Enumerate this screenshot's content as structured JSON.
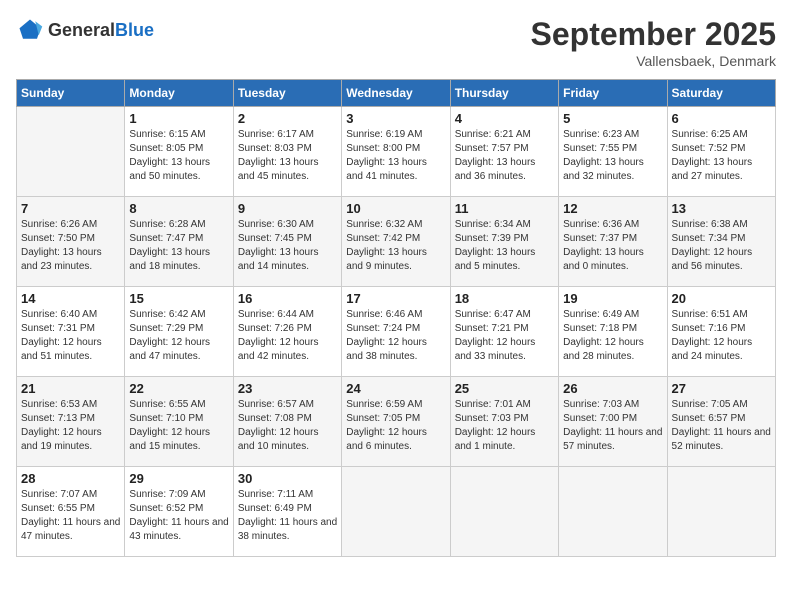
{
  "logo": {
    "text_general": "General",
    "text_blue": "Blue"
  },
  "header": {
    "month": "September 2025",
    "location": "Vallensbaek, Denmark"
  },
  "days_of_week": [
    "Sunday",
    "Monday",
    "Tuesday",
    "Wednesday",
    "Thursday",
    "Friday",
    "Saturday"
  ],
  "weeks": [
    [
      {
        "day": "",
        "sunrise": "",
        "sunset": "",
        "daylight": ""
      },
      {
        "day": "1",
        "sunrise": "Sunrise: 6:15 AM",
        "sunset": "Sunset: 8:05 PM",
        "daylight": "Daylight: 13 hours and 50 minutes."
      },
      {
        "day": "2",
        "sunrise": "Sunrise: 6:17 AM",
        "sunset": "Sunset: 8:03 PM",
        "daylight": "Daylight: 13 hours and 45 minutes."
      },
      {
        "day": "3",
        "sunrise": "Sunrise: 6:19 AM",
        "sunset": "Sunset: 8:00 PM",
        "daylight": "Daylight: 13 hours and 41 minutes."
      },
      {
        "day": "4",
        "sunrise": "Sunrise: 6:21 AM",
        "sunset": "Sunset: 7:57 PM",
        "daylight": "Daylight: 13 hours and 36 minutes."
      },
      {
        "day": "5",
        "sunrise": "Sunrise: 6:23 AM",
        "sunset": "Sunset: 7:55 PM",
        "daylight": "Daylight: 13 hours and 32 minutes."
      },
      {
        "day": "6",
        "sunrise": "Sunrise: 6:25 AM",
        "sunset": "Sunset: 7:52 PM",
        "daylight": "Daylight: 13 hours and 27 minutes."
      }
    ],
    [
      {
        "day": "7",
        "sunrise": "Sunrise: 6:26 AM",
        "sunset": "Sunset: 7:50 PM",
        "daylight": "Daylight: 13 hours and 23 minutes."
      },
      {
        "day": "8",
        "sunrise": "Sunrise: 6:28 AM",
        "sunset": "Sunset: 7:47 PM",
        "daylight": "Daylight: 13 hours and 18 minutes."
      },
      {
        "day": "9",
        "sunrise": "Sunrise: 6:30 AM",
        "sunset": "Sunset: 7:45 PM",
        "daylight": "Daylight: 13 hours and 14 minutes."
      },
      {
        "day": "10",
        "sunrise": "Sunrise: 6:32 AM",
        "sunset": "Sunset: 7:42 PM",
        "daylight": "Daylight: 13 hours and 9 minutes."
      },
      {
        "day": "11",
        "sunrise": "Sunrise: 6:34 AM",
        "sunset": "Sunset: 7:39 PM",
        "daylight": "Daylight: 13 hours and 5 minutes."
      },
      {
        "day": "12",
        "sunrise": "Sunrise: 6:36 AM",
        "sunset": "Sunset: 7:37 PM",
        "daylight": "Daylight: 13 hours and 0 minutes."
      },
      {
        "day": "13",
        "sunrise": "Sunrise: 6:38 AM",
        "sunset": "Sunset: 7:34 PM",
        "daylight": "Daylight: 12 hours and 56 minutes."
      }
    ],
    [
      {
        "day": "14",
        "sunrise": "Sunrise: 6:40 AM",
        "sunset": "Sunset: 7:31 PM",
        "daylight": "Daylight: 12 hours and 51 minutes."
      },
      {
        "day": "15",
        "sunrise": "Sunrise: 6:42 AM",
        "sunset": "Sunset: 7:29 PM",
        "daylight": "Daylight: 12 hours and 47 minutes."
      },
      {
        "day": "16",
        "sunrise": "Sunrise: 6:44 AM",
        "sunset": "Sunset: 7:26 PM",
        "daylight": "Daylight: 12 hours and 42 minutes."
      },
      {
        "day": "17",
        "sunrise": "Sunrise: 6:46 AM",
        "sunset": "Sunset: 7:24 PM",
        "daylight": "Daylight: 12 hours and 38 minutes."
      },
      {
        "day": "18",
        "sunrise": "Sunrise: 6:47 AM",
        "sunset": "Sunset: 7:21 PM",
        "daylight": "Daylight: 12 hours and 33 minutes."
      },
      {
        "day": "19",
        "sunrise": "Sunrise: 6:49 AM",
        "sunset": "Sunset: 7:18 PM",
        "daylight": "Daylight: 12 hours and 28 minutes."
      },
      {
        "day": "20",
        "sunrise": "Sunrise: 6:51 AM",
        "sunset": "Sunset: 7:16 PM",
        "daylight": "Daylight: 12 hours and 24 minutes."
      }
    ],
    [
      {
        "day": "21",
        "sunrise": "Sunrise: 6:53 AM",
        "sunset": "Sunset: 7:13 PM",
        "daylight": "Daylight: 12 hours and 19 minutes."
      },
      {
        "day": "22",
        "sunrise": "Sunrise: 6:55 AM",
        "sunset": "Sunset: 7:10 PM",
        "daylight": "Daylight: 12 hours and 15 minutes."
      },
      {
        "day": "23",
        "sunrise": "Sunrise: 6:57 AM",
        "sunset": "Sunset: 7:08 PM",
        "daylight": "Daylight: 12 hours and 10 minutes."
      },
      {
        "day": "24",
        "sunrise": "Sunrise: 6:59 AM",
        "sunset": "Sunset: 7:05 PM",
        "daylight": "Daylight: 12 hours and 6 minutes."
      },
      {
        "day": "25",
        "sunrise": "Sunrise: 7:01 AM",
        "sunset": "Sunset: 7:03 PM",
        "daylight": "Daylight: 12 hours and 1 minute."
      },
      {
        "day": "26",
        "sunrise": "Sunrise: 7:03 AM",
        "sunset": "Sunset: 7:00 PM",
        "daylight": "Daylight: 11 hours and 57 minutes."
      },
      {
        "day": "27",
        "sunrise": "Sunrise: 7:05 AM",
        "sunset": "Sunset: 6:57 PM",
        "daylight": "Daylight: 11 hours and 52 minutes."
      }
    ],
    [
      {
        "day": "28",
        "sunrise": "Sunrise: 7:07 AM",
        "sunset": "Sunset: 6:55 PM",
        "daylight": "Daylight: 11 hours and 47 minutes."
      },
      {
        "day": "29",
        "sunrise": "Sunrise: 7:09 AM",
        "sunset": "Sunset: 6:52 PM",
        "daylight": "Daylight: 11 hours and 43 minutes."
      },
      {
        "day": "30",
        "sunrise": "Sunrise: 7:11 AM",
        "sunset": "Sunset: 6:49 PM",
        "daylight": "Daylight: 11 hours and 38 minutes."
      },
      {
        "day": "",
        "sunrise": "",
        "sunset": "",
        "daylight": ""
      },
      {
        "day": "",
        "sunrise": "",
        "sunset": "",
        "daylight": ""
      },
      {
        "day": "",
        "sunrise": "",
        "sunset": "",
        "daylight": ""
      },
      {
        "day": "",
        "sunrise": "",
        "sunset": "",
        "daylight": ""
      }
    ]
  ]
}
